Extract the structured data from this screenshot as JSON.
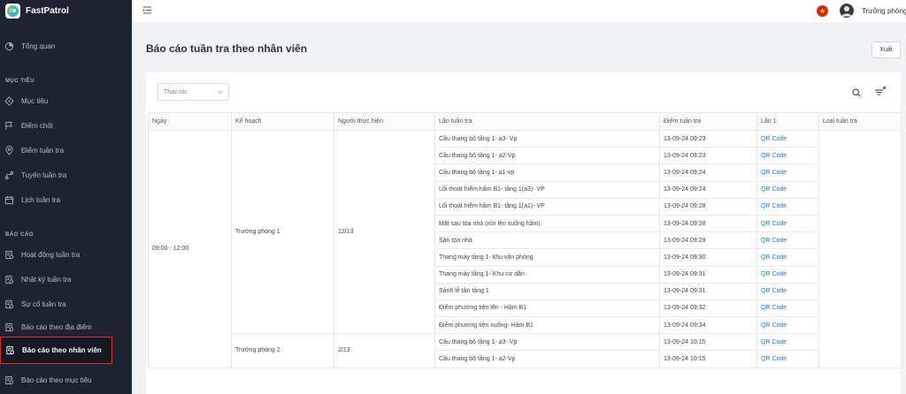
{
  "app": {
    "name": "FastPatrol",
    "logo_text": "FW"
  },
  "sidebar": {
    "overview": {
      "label": "Tổng quan"
    },
    "sections": [
      {
        "title": "MỤC TIÊU"
      },
      {
        "title": "BÁO CÁO"
      }
    ],
    "target_items": [
      {
        "label": "Mục tiêu",
        "icon": "target-icon"
      },
      {
        "label": "Điểm chốt",
        "icon": "flag-icon"
      },
      {
        "label": "Điểm tuần tra",
        "icon": "location-pin-icon"
      },
      {
        "label": "Tuyến tuần tra",
        "icon": "route-icon"
      },
      {
        "label": "Lịch tuần tra",
        "icon": "calendar-icon"
      }
    ],
    "report_items": [
      {
        "label": "Hoạt động tuần tra",
        "icon": "report-icon"
      },
      {
        "label": "Nhật ký tuần tra",
        "icon": "report-icon"
      },
      {
        "label": "Sự cố tuần tra",
        "icon": "report-icon"
      },
      {
        "label": "Báo cáo theo địa điểm",
        "icon": "report-icon"
      },
      {
        "label": "Báo cáo theo nhân viên",
        "icon": "report-icon",
        "active": true
      },
      {
        "label": "Báo cáo theo mục tiêu",
        "icon": "report-icon"
      }
    ]
  },
  "topbar": {
    "menu_icon": "menu-fold-icon",
    "language_flag": "vietnam-flag-icon",
    "user_name": "Trưởng phòng"
  },
  "page": {
    "title": "Báo cáo tuần tra theo nhân viên",
    "export_label": "Xuất",
    "action_placeholder": "Thao tác"
  },
  "table": {
    "columns": [
      "Ngày",
      "Kế hoạch",
      "Người thực hiện",
      "Lần tuần tra",
      "Điểm tuần tra",
      "Lần 1",
      "Loại tuần tra"
    ],
    "date": "09:00 - 12:00",
    "groups": [
      {
        "plan": "Trưởng phòng 1",
        "count": "12/13",
        "rows": [
          {
            "point": "Cầu thang bộ tầng 1- a3- Vp",
            "time": "13-09-24 09:23",
            "link": "QR Code"
          },
          {
            "point": "Cầu thang bộ tầng 1- a2-Vp",
            "time": "13-09-24 09:23",
            "link": "QR Code"
          },
          {
            "point": "Cầu thang bộ tầng 1- a1-vp",
            "time": "13-09-24 09:24",
            "link": "QR Code"
          },
          {
            "point": "Lối thoát hiểm hầm B1- tầng 1(a3)- VP",
            "time": "13-09-24 09:24",
            "link": "QR Code"
          },
          {
            "point": "Lối thoát hiểm hầm B1- tầng 1(a1)- VP",
            "time": "13-09-24 09:28",
            "link": "QR Code"
          },
          {
            "point": "Mặt sau tòa nhà (nơi lên xuống hầm)",
            "time": "13-09-24 09:28",
            "link": "QR Code"
          },
          {
            "point": "Sân tòa nhà",
            "time": "13-09-24 09:29",
            "link": "QR Code"
          },
          {
            "point": "Thang máy tầng 1- khu văn phòng",
            "time": "13-09-24 09:30",
            "link": "QR Code"
          },
          {
            "point": "Thang máy tầng 1- Khu cư dân",
            "time": "13-09-24 09:31",
            "link": "QR Code"
          },
          {
            "point": "Sảnh lễ tân tầng 1",
            "time": "13-09-24 09:31",
            "link": "QR Code"
          },
          {
            "point": "Điểm phương tiện lên - Hầm B1",
            "time": "13-09-24 09:32",
            "link": "QR Code"
          },
          {
            "point": "Điểm phương tiện xuống- Hầm B1",
            "time": "13-09-24 09:34",
            "link": "QR Code"
          }
        ]
      },
      {
        "plan": "Trưởng phòng 2",
        "count": "2/13",
        "rows": [
          {
            "point": "Cầu thang bộ tầng 1- a3- Vp",
            "time": "13-09-24 10:15",
            "link": "QR Code"
          },
          {
            "point": "Cầu thang bộ tầng 1- a2-Vp",
            "time": "13-09-24 10:15",
            "link": "QR Code"
          }
        ]
      }
    ]
  }
}
